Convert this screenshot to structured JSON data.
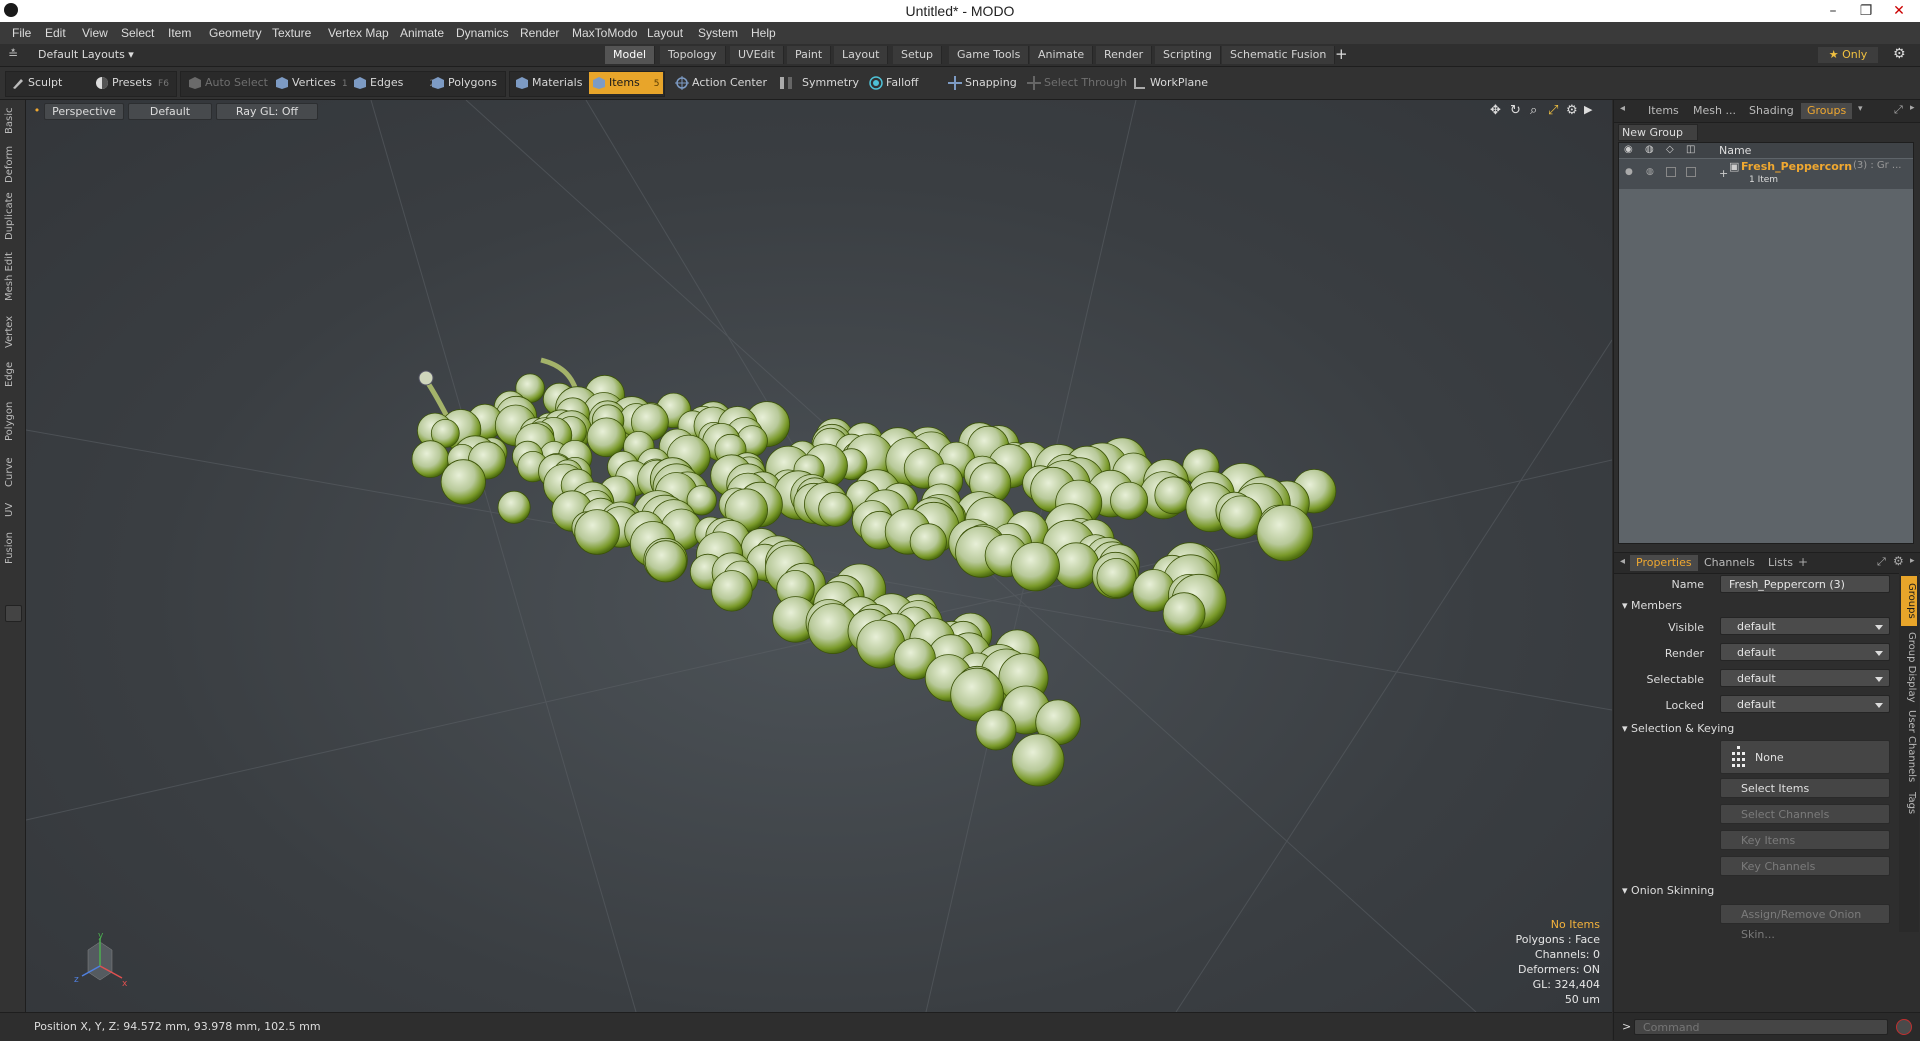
{
  "window": {
    "title": "Untitled* - MODO",
    "minimize": "–",
    "restore": "❐",
    "close": "✕"
  },
  "menubar": [
    "File",
    "Edit",
    "View",
    "Select",
    "Item",
    "Geometry",
    "Texture",
    "Vertex Map",
    "Animate",
    "Dynamics",
    "Render",
    "MaxToModo",
    "Layout",
    "System",
    "Help"
  ],
  "layout": {
    "selector": "Default Layouts ▾",
    "tabs": [
      "Model",
      "Topology",
      "UVEdit",
      "Paint",
      "Layout",
      "Setup",
      "Game Tools",
      "Animate",
      "Render",
      "Scripting",
      "Schematic Fusion"
    ],
    "active_tab": "Model",
    "add": "+",
    "only_label": "★ Only"
  },
  "toolbar": {
    "sculpt": "Sculpt",
    "presets": "Presets",
    "presets_key": "F6",
    "auto_select": "Auto Select",
    "vertices": "Vertices",
    "vertices_key": "1",
    "edges": "Edges",
    "edges_key": "2",
    "polygons": "Polygons",
    "materials": "Materials",
    "items": "Items",
    "items_key": "5",
    "action_center": "Action Center",
    "symmetry": "Symmetry",
    "falloff": "Falloff",
    "snapping": "Snapping",
    "select_through": "Select Through",
    "workplane": "WorkPlane",
    "accent": "#e8a52a"
  },
  "left_tabs": [
    "Basic",
    "Deform",
    "Duplicate",
    "Mesh Edit",
    "Vertex",
    "Edge",
    "Polygon",
    "Curve",
    "UV",
    "Fusion"
  ],
  "viewport": {
    "view": "Perspective",
    "shading": "Default",
    "raygl": "Ray GL: Off",
    "info": {
      "selection": "No Items",
      "polygons": "Polygons : Face",
      "channels": "Channels: 0",
      "deformers": "Deformers: ON",
      "gl": "GL: 324,404",
      "scale": "50 um"
    },
    "axis": {
      "x": "x",
      "y": "y",
      "z": "z"
    }
  },
  "status": {
    "position": "Position X, Y, Z:   94.572 mm, 93.978 mm, 102.5 mm"
  },
  "groups_panel": {
    "tabs": [
      "Items",
      "Mesh ...",
      "Shading",
      "Groups"
    ],
    "active_tab": "Groups",
    "new_group": "New Group",
    "col_name": "Name",
    "group_name": "Fresh_Peppercorn",
    "group_count": "(3) : Gr ...",
    "group_sub": "1 Item"
  },
  "properties": {
    "tabs": [
      "Properties",
      "Channels",
      "Lists"
    ],
    "active_tab": "Properties",
    "add": "+",
    "name_label": "Name",
    "name_value": "Fresh_Peppercorn (3)",
    "members_header": "Members",
    "visible_label": "Visible",
    "visible_value": "default",
    "render_label": "Render",
    "render_value": "default",
    "selectable_label": "Selectable",
    "selectable_value": "default",
    "locked_label": "Locked",
    "locked_value": "default",
    "sel_keying_header": "Selection & Keying",
    "none_btn": "None",
    "select_items": "Select Items",
    "select_channels": "Select Channels",
    "key_items": "Key Items",
    "key_channels": "Key Channels",
    "onion_header": "Onion Skinning",
    "onion_btn": "Assign/Remove Onion Skin...",
    "side_tabs": [
      "Groups",
      "Group Display",
      "User Channels",
      "Tags"
    ]
  },
  "command": {
    "prompt": ">",
    "placeholder": "Command"
  }
}
